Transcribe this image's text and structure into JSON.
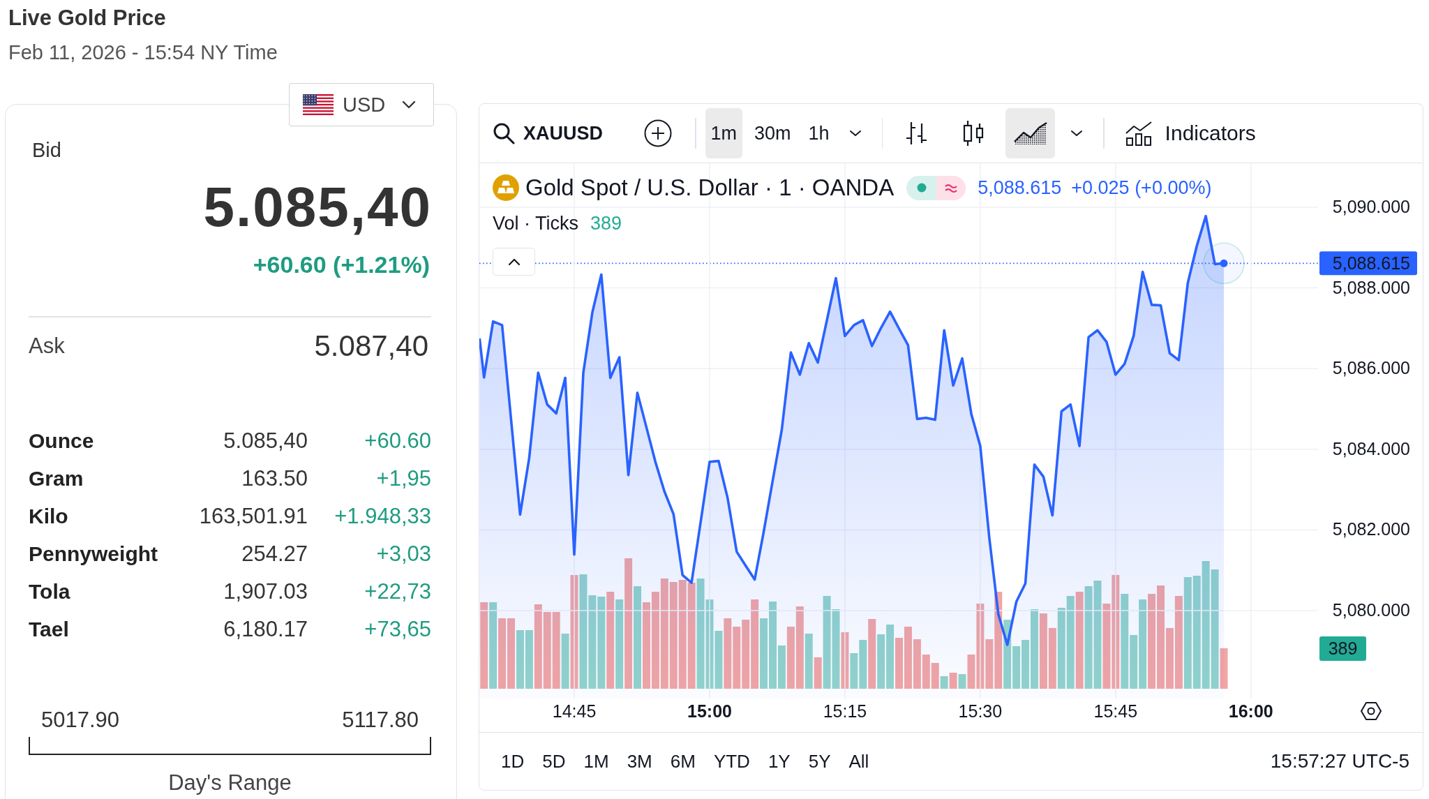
{
  "header": {
    "title": "Live Gold Price",
    "timestamp": "Feb 11, 2026 - 15:54 NY Time"
  },
  "currency_select": {
    "value": "USD"
  },
  "quote": {
    "bid_label": "Bid",
    "bid": "5.085,40",
    "change": "+60.60 (+1.21%)",
    "ask_label": "Ask",
    "ask": "5.087,40"
  },
  "units": [
    {
      "name": "Ounce",
      "price": "5.085,40",
      "change": "+60.60"
    },
    {
      "name": "Gram",
      "price": "163.50",
      "change": "+1,95"
    },
    {
      "name": "Kilo",
      "price": "163,501.91",
      "change": "+1.948,33"
    },
    {
      "name": "Pennyweight",
      "price": "254.27",
      "change": "+3,03"
    },
    {
      "name": "Tola",
      "price": "1,907.03",
      "change": "+22,73"
    },
    {
      "name": "Tael",
      "price": "6,180.17",
      "change": "+73,65"
    }
  ],
  "day_range": {
    "low": "5017.90",
    "high": "5117.80",
    "label": "Day's Range"
  },
  "chart_panel": {
    "toolbar": {
      "symbol": "XAUUSD",
      "intervals": [
        {
          "label": "1m",
          "selected": true
        },
        {
          "label": "30m",
          "selected": false
        },
        {
          "label": "1h",
          "selected": false
        }
      ],
      "chart_styles": [
        {
          "kind": "bars",
          "selected": false
        },
        {
          "kind": "candles",
          "selected": false
        },
        {
          "kind": "area",
          "selected": true
        }
      ],
      "indicators": "Indicators"
    },
    "legend": {
      "symbol_title": "Gold Spot / U.S. Dollar · 1 · OANDA",
      "market_open": true,
      "last_price": "5,088.615",
      "change": "+0.025 (+0.00%)",
      "volume_label": "Vol · Ticks",
      "volume": "389"
    },
    "price_scale": {
      "last_price_tag": "5,088.615",
      "volume_tag": "389"
    },
    "chart_data": {
      "type": "area",
      "x": [
        874.5,
        875,
        876,
        877,
        878,
        879,
        880,
        881,
        882,
        883,
        884,
        885,
        886,
        887,
        888,
        889,
        890,
        891,
        892,
        893,
        894,
        895,
        896,
        897,
        898,
        899,
        900,
        901,
        902,
        903,
        904,
        905,
        906,
        907,
        908,
        909,
        910,
        911,
        912,
        913,
        914,
        915,
        916,
        917,
        918,
        919,
        920,
        921,
        922,
        923,
        924,
        925,
        926,
        927,
        928,
        929,
        930,
        931,
        932,
        933,
        934,
        935,
        936,
        937,
        938,
        939,
        940,
        941,
        942,
        943,
        944,
        945,
        946,
        947,
        948,
        949,
        950,
        951,
        952,
        953,
        954,
        955,
        956,
        957
      ],
      "values": [
        5086.75,
        5085.78,
        5087.17,
        5087.08,
        5084.73,
        5082.38,
        5083.78,
        5085.9,
        5085.11,
        5084.89,
        5085.77,
        5081.39,
        5085.9,
        5087.39,
        5088.33,
        5085.77,
        5086.28,
        5083.36,
        5085.4,
        5084.54,
        5083.68,
        5082.95,
        5082.39,
        5080.88,
        5080.69,
        5082.19,
        5083.69,
        5083.71,
        5082.79,
        5081.46,
        5081.11,
        5080.77,
        5081.96,
        5083.23,
        5084.48,
        5086.4,
        5085.85,
        5086.63,
        5086.15,
        5087.2,
        5088.24,
        5086.81,
        5087.08,
        5087.2,
        5086.56,
        5087.01,
        5087.41,
        5086.99,
        5086.58,
        5084.75,
        5084.78,
        5084.73,
        5086.95,
        5085.58,
        5086.25,
        5084.88,
        5084.08,
        5081.81,
        5079.91,
        5079.15,
        5080.22,
        5080.67,
        5083.62,
        5083.32,
        5082.36,
        5084.94,
        5085.11,
        5084.08,
        5086.78,
        5086.95,
        5086.66,
        5085.85,
        5086.12,
        5086.81,
        5088.4,
        5087.58,
        5087.57,
        5086.38,
        5086.21,
        5088.12,
        5089.04,
        5089.78,
        5088.59,
        5088.61
      ],
      "xlim": [
        874.48,
        967.44
      ],
      "ylim": [
        5077.82,
        5091.09
      ],
      "grid": true,
      "xticks": [
        {
          "value": 885,
          "label": "14:45"
        },
        {
          "value": 900,
          "label": "15:00"
        },
        {
          "value": 915,
          "label": "15:15"
        },
        {
          "value": 930,
          "label": "15:30"
        },
        {
          "value": 945,
          "label": "15:45"
        },
        {
          "value": 960,
          "label": "16:00"
        }
      ],
      "yticks": [
        {
          "value": 5090,
          "label": "5,090.000"
        },
        {
          "value": 5088,
          "label": "5,088.000"
        },
        {
          "value": 5086,
          "label": "5,086.000"
        },
        {
          "value": 5084,
          "label": "5,084.000"
        },
        {
          "value": 5082,
          "label": "5,082.000"
        },
        {
          "value": 5080,
          "label": "5,080.000"
        }
      ]
    },
    "ranges": [
      "1D",
      "5D",
      "1M",
      "3M",
      "6M",
      "YTD",
      "1Y",
      "5Y",
      "All"
    ],
    "clock": "15:57:27 UTC-5"
  }
}
